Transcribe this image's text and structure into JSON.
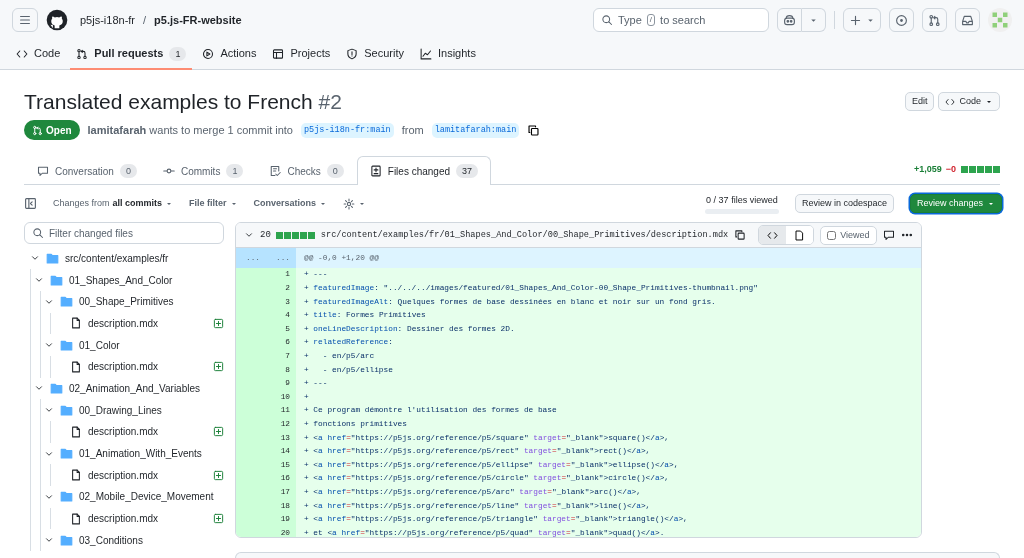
{
  "header": {
    "owner": "p5js-i18n-fr",
    "separator": "/",
    "repo": "p5.js-FR-website",
    "search": {
      "before": "Type",
      "key": "/",
      "after": "to search"
    }
  },
  "repo_nav": [
    {
      "label": "Code",
      "selected": false
    },
    {
      "label": "Pull requests",
      "count": "1",
      "selected": true
    },
    {
      "label": "Actions",
      "selected": false
    },
    {
      "label": "Projects",
      "selected": false
    },
    {
      "label": "Security",
      "selected": false
    },
    {
      "label": "Insights",
      "selected": false
    }
  ],
  "pull_request": {
    "title": "Translated examples to French",
    "number": "#2",
    "state": "Open",
    "author": "lamitafarah",
    "summary": "wants to merge 1 commit into",
    "base": "p5js-i18n-fr:main",
    "from": "from",
    "head": "lamitafarah:main",
    "buttons": {
      "edit": "Edit",
      "code": "Code"
    }
  },
  "tabs": [
    {
      "label": "Conversation",
      "count": "0",
      "selected": false
    },
    {
      "label": "Commits",
      "count": "1",
      "selected": false
    },
    {
      "label": "Checks",
      "count": "0",
      "selected": false
    },
    {
      "label": "Files changed",
      "count": "37",
      "selected": true
    }
  ],
  "diffstat": {
    "added": "+1,059",
    "removed": "−0"
  },
  "toolbar": {
    "changes_prefix": "Changes from",
    "changes_value": "all commits",
    "file_filter": "File filter",
    "conversations": "Conversations",
    "files_viewed": {
      "text": "0 / 37 files viewed",
      "level": 0
    },
    "review_codespace": "Review in codespace",
    "review_changes": "Review changes"
  },
  "file_tree": {
    "placeholder": "Filter changed files",
    "items": [
      {
        "kind": "folder",
        "name": "src/content/examples/fr",
        "expanded": true,
        "children": [
          {
            "kind": "folder",
            "name": "01_Shapes_And_Color",
            "expanded": true,
            "children": [
              {
                "kind": "folder",
                "name": "00_Shape_Primitives",
                "expanded": true,
                "children": [
                  {
                    "kind": "file",
                    "name": "description.mdx",
                    "added": true
                  }
                ]
              },
              {
                "kind": "folder",
                "name": "01_Color",
                "expanded": true,
                "children": [
                  {
                    "kind": "file",
                    "name": "description.mdx",
                    "added": true
                  }
                ]
              }
            ]
          },
          {
            "kind": "folder",
            "name": "02_Animation_And_Variables",
            "expanded": true,
            "children": [
              {
                "kind": "folder",
                "name": "00_Drawing_Lines",
                "expanded": true,
                "children": [
                  {
                    "kind": "file",
                    "name": "description.mdx",
                    "added": true
                  }
                ]
              },
              {
                "kind": "folder",
                "name": "01_Animation_With_Events",
                "expanded": true,
                "children": [
                  {
                    "kind": "file",
                    "name": "description.mdx",
                    "added": true
                  }
                ]
              },
              {
                "kind": "folder",
                "name": "02_Mobile_Device_Movement",
                "expanded": true,
                "children": [
                  {
                    "kind": "file",
                    "name": "description.mdx",
                    "added": true
                  }
                ]
              },
              {
                "kind": "folder",
                "name": "03_Conditions",
                "expanded": true
              }
            ]
          }
        ]
      }
    ]
  },
  "diff": {
    "count": "20",
    "path": "src/content/examples/fr/01_Shapes_And_Color/00_Shape_Primitives/description.mdx",
    "viewed_label": "Viewed",
    "viewed": false,
    "hunk_old": "...",
    "hunk_new": "...",
    "hunk": "@@ -0,0 +1,20 @@",
    "lines": [
      {
        "number": "1",
        "parts": [
          {
            "kind": "plain",
            "text": "+ ---"
          }
        ]
      },
      {
        "number": "2",
        "parts": [
          {
            "kind": "plain",
            "text": "+ "
          },
          {
            "kind": "key",
            "text": "featuredImage"
          },
          {
            "kind": "plain",
            "text": ": \"../../../images/featured/01_Shapes_And_Color-00_Shape_Primitives-thumbnail.png\""
          }
        ]
      },
      {
        "number": "3",
        "parts": [
          {
            "kind": "plain",
            "text": "+ "
          },
          {
            "kind": "key",
            "text": "featuredImageAlt"
          },
          {
            "kind": "plain",
            "text": ": Quelques formes de base dessinées en blanc et noir sur un fond gris."
          }
        ]
      },
      {
        "number": "4",
        "parts": [
          {
            "kind": "plain",
            "text": "+ "
          },
          {
            "kind": "key",
            "text": "title"
          },
          {
            "kind": "plain",
            "text": ": Formes Primitives"
          }
        ]
      },
      {
        "number": "5",
        "parts": [
          {
            "kind": "plain",
            "text": "+ "
          },
          {
            "kind": "key",
            "text": "oneLineDescription"
          },
          {
            "kind": "plain",
            "text": ": Dessiner des formes 2D."
          }
        ]
      },
      {
        "number": "6",
        "parts": [
          {
            "kind": "plain",
            "text": "+ "
          },
          {
            "kind": "key",
            "text": "relatedReference"
          },
          {
            "kind": "plain",
            "text": ":"
          }
        ]
      },
      {
        "number": "7",
        "parts": [
          {
            "kind": "plain",
            "text": "+   - en/p5/arc"
          }
        ]
      },
      {
        "number": "8",
        "parts": [
          {
            "kind": "plain",
            "text": "+   - en/p5/ellipse"
          }
        ]
      },
      {
        "number": "9",
        "parts": [
          {
            "kind": "plain",
            "text": "+ ---"
          }
        ]
      },
      {
        "number": "10",
        "parts": [
          {
            "kind": "plain",
            "text": "+"
          }
        ]
      },
      {
        "number": "11",
        "parts": [
          {
            "kind": "plain",
            "text": "+ Ce program démontre l'utilisation des formes de base"
          }
        ]
      },
      {
        "number": "12",
        "parts": [
          {
            "kind": "plain",
            "text": "+ fonctions primitives"
          }
        ]
      },
      {
        "number": "13",
        "parts": [
          {
            "kind": "plain",
            "text": "+ <"
          },
          {
            "kind": "key",
            "text": "a href"
          },
          {
            "kind": "op",
            "text": "="
          },
          {
            "kind": "plain",
            "text": "\"https://p5js.org/reference/p5/square\" "
          },
          {
            "kind": "attr",
            "text": "target"
          },
          {
            "kind": "op",
            "text": "="
          },
          {
            "kind": "plain",
            "text": "\"_blank\">square()</"
          },
          {
            "kind": "key",
            "text": "a"
          },
          {
            "kind": "plain",
            "text": ">,"
          }
        ]
      },
      {
        "number": "14",
        "parts": [
          {
            "kind": "plain",
            "text": "+ <"
          },
          {
            "kind": "key",
            "text": "a href"
          },
          {
            "kind": "op",
            "text": "="
          },
          {
            "kind": "plain",
            "text": "\"https://p5js.org/reference/p5/rect\" "
          },
          {
            "kind": "attr",
            "text": "target"
          },
          {
            "kind": "op",
            "text": "="
          },
          {
            "kind": "plain",
            "text": "\"_blank\">rect()</"
          },
          {
            "kind": "key",
            "text": "a"
          },
          {
            "kind": "plain",
            "text": ">,"
          }
        ]
      },
      {
        "number": "15",
        "parts": [
          {
            "kind": "plain",
            "text": "+ <"
          },
          {
            "kind": "key",
            "text": "a href"
          },
          {
            "kind": "op",
            "text": "="
          },
          {
            "kind": "plain",
            "text": "\"https://p5js.org/reference/p5/ellipse\" "
          },
          {
            "kind": "attr",
            "text": "target"
          },
          {
            "kind": "op",
            "text": "="
          },
          {
            "kind": "plain",
            "text": "\"_blank\">ellipse()</"
          },
          {
            "kind": "key",
            "text": "a"
          },
          {
            "kind": "plain",
            "text": ">,"
          }
        ]
      },
      {
        "number": "16",
        "parts": [
          {
            "kind": "plain",
            "text": "+ <"
          },
          {
            "kind": "key",
            "text": "a href"
          },
          {
            "kind": "op",
            "text": "="
          },
          {
            "kind": "plain",
            "text": "\"https://p5js.org/reference/p5/circle\" "
          },
          {
            "kind": "attr",
            "text": "target"
          },
          {
            "kind": "op",
            "text": "="
          },
          {
            "kind": "plain",
            "text": "\"_blank\">circle()</"
          },
          {
            "kind": "key",
            "text": "a"
          },
          {
            "kind": "plain",
            "text": ">,"
          }
        ]
      },
      {
        "number": "17",
        "parts": [
          {
            "kind": "plain",
            "text": "+ <"
          },
          {
            "kind": "key",
            "text": "a href"
          },
          {
            "kind": "op",
            "text": "="
          },
          {
            "kind": "plain",
            "text": "\"https://p5js.org/reference/p5/arc\" "
          },
          {
            "kind": "attr",
            "text": "target"
          },
          {
            "kind": "op",
            "text": "="
          },
          {
            "kind": "plain",
            "text": "\"_blank\">arc()</"
          },
          {
            "kind": "key",
            "text": "a"
          },
          {
            "kind": "plain",
            "text": ">,"
          }
        ]
      },
      {
        "number": "18",
        "parts": [
          {
            "kind": "plain",
            "text": "+ <"
          },
          {
            "kind": "key",
            "text": "a href"
          },
          {
            "kind": "op",
            "text": "="
          },
          {
            "kind": "plain",
            "text": "\"https://p5js.org/reference/p5/line\" "
          },
          {
            "kind": "attr",
            "text": "target"
          },
          {
            "kind": "op",
            "text": "="
          },
          {
            "kind": "plain",
            "text": "\"_blank\">line()</"
          },
          {
            "kind": "key",
            "text": "a"
          },
          {
            "kind": "plain",
            "text": ">,"
          }
        ]
      },
      {
        "number": "19",
        "parts": [
          {
            "kind": "plain",
            "text": "+ <"
          },
          {
            "kind": "key",
            "text": "a href"
          },
          {
            "kind": "op",
            "text": "="
          },
          {
            "kind": "plain",
            "text": "\"https://p5js.org/reference/p5/triangle\" "
          },
          {
            "kind": "attr",
            "text": "target"
          },
          {
            "kind": "op",
            "text": "="
          },
          {
            "kind": "plain",
            "text": "\"_blank\">triangle()</"
          },
          {
            "kind": "key",
            "text": "a"
          },
          {
            "kind": "plain",
            "text": ">,"
          }
        ]
      },
      {
        "number": "20",
        "parts": [
          {
            "kind": "plain",
            "text": "+ et <"
          },
          {
            "kind": "key",
            "text": "a href"
          },
          {
            "kind": "op",
            "text": "="
          },
          {
            "kind": "plain",
            "text": "\"https://p5js.org/reference/p5/quad\" "
          },
          {
            "kind": "attr",
            "text": "target"
          },
          {
            "kind": "op",
            "text": "="
          },
          {
            "kind": "plain",
            "text": "\"_blank\">quad()</"
          },
          {
            "kind": "key",
            "text": "a"
          },
          {
            "kind": "plain",
            "text": ">."
          }
        ]
      }
    ]
  }
}
